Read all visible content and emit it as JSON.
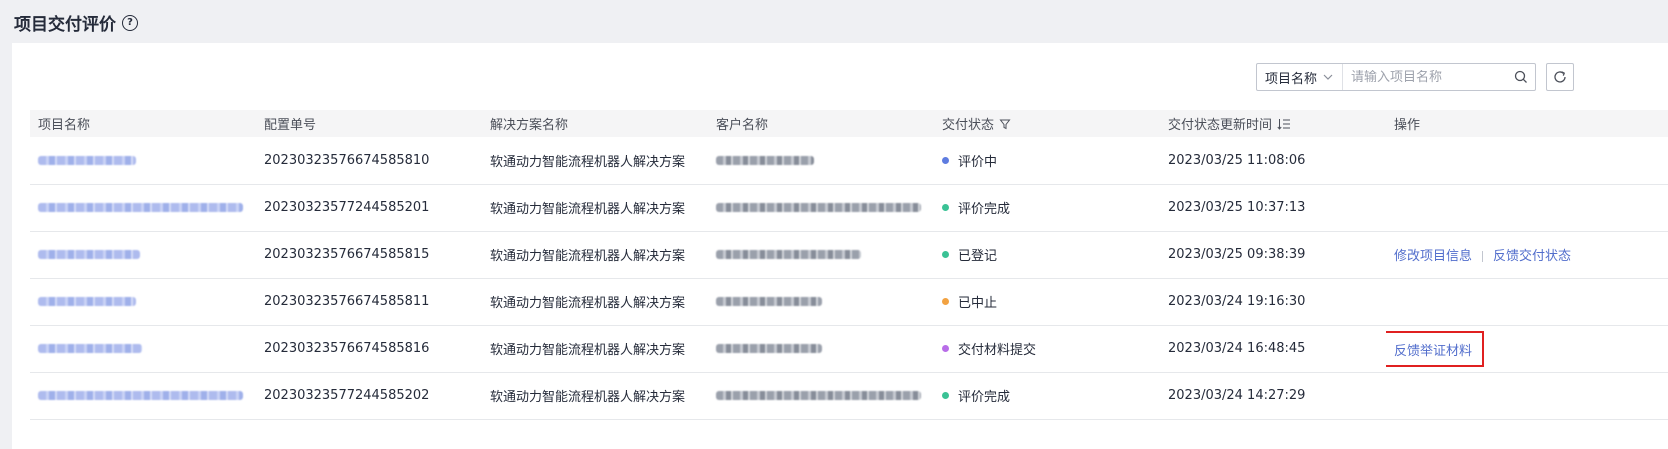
{
  "page": {
    "title": "项目交付评价",
    "help_icon": "question-circle-icon"
  },
  "toolbar": {
    "search_field_label": "项目名称",
    "search_placeholder": "请输入项目名称",
    "search_icon": "search-icon",
    "refresh_icon": "refresh-icon"
  },
  "table": {
    "headers": {
      "project_name": "项目名称",
      "config_no": "配置单号",
      "solution": "解决方案名称",
      "customer": "客户名称",
      "status": "交付状态",
      "updated": "交付状态更新时间",
      "actions": "操作"
    },
    "rows": [
      {
        "config_no": "20230323576674585810",
        "solution": "软通动力智能流程机器人解决方案",
        "status": "评价中",
        "status_color": "#5e7ce0",
        "updated": "2023/03/25 11:08:06",
        "actions": []
      },
      {
        "config_no": "20230323577244585201",
        "solution": "软通动力智能流程机器人解决方案",
        "status": "评价完成",
        "status_color": "#3ac295",
        "updated": "2023/03/25 10:37:13",
        "actions": []
      },
      {
        "config_no": "20230323576674585815",
        "solution": "软通动力智能流程机器人解决方案",
        "status": "已登记",
        "status_color": "#3ac295",
        "updated": "2023/03/25 09:38:39",
        "actions": [
          "修改项目信息",
          "反馈交付状态"
        ]
      },
      {
        "config_no": "20230323576674585811",
        "solution": "软通动力智能流程机器人解决方案",
        "status": "已中止",
        "status_color": "#f2a242",
        "updated": "2023/03/24 19:16:30",
        "actions": []
      },
      {
        "config_no": "20230323576674585816",
        "solution": "软通动力智能流程机器人解决方案",
        "status": "交付材料提交",
        "status_color": "#b86de8",
        "updated": "2023/03/24 16:48:45",
        "actions": [
          "反馈举证材料"
        ]
      },
      {
        "config_no": "20230323577244585202",
        "solution": "软通动力智能流程机器人解决方案",
        "status": "评价完成",
        "status_color": "#3ac295",
        "updated": "2023/03/24 14:27:29",
        "actions": []
      }
    ]
  }
}
